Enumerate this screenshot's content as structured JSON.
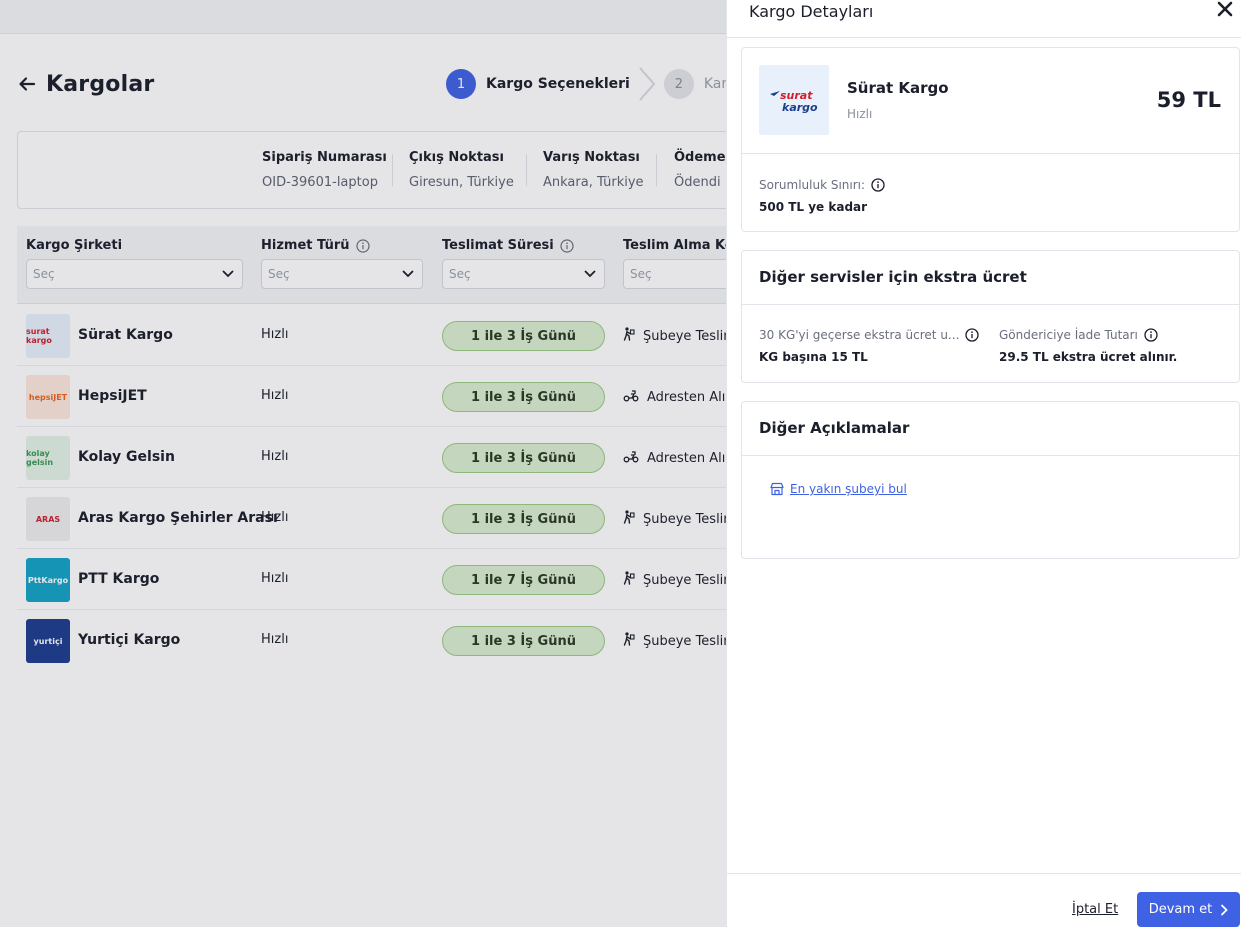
{
  "page": {
    "title": "Kargolar"
  },
  "stepper": {
    "steps": [
      {
        "number": "1",
        "label": "Kargo Seçenekleri"
      },
      {
        "number": "2",
        "label": "Kargo O"
      }
    ]
  },
  "order_info": {
    "fields": [
      {
        "label": "Sipariş Numarası",
        "value": "OID-39601-laptop"
      },
      {
        "label": "Çıkış Noktası",
        "value": "Giresun, Türkiye"
      },
      {
        "label": "Varış Noktası",
        "value": "Ankara, Türkiye"
      },
      {
        "label": "Ödeme T",
        "value": "Ödendi"
      }
    ]
  },
  "table": {
    "columns": [
      {
        "label": "Kargo Şirketi",
        "placeholder": "Seç"
      },
      {
        "label": "Hizmet Türü",
        "placeholder": "Seç"
      },
      {
        "label": "Teslimat Süresi",
        "placeholder": "Seç"
      },
      {
        "label": "Teslim Alma Koş",
        "placeholder": "Seç"
      }
    ],
    "rows": [
      {
        "company": "Sürat Kargo",
        "logo_text": "surat kargo",
        "logo_bg": "#e8f1fb",
        "logo_color": "#d0202e",
        "service": "Hızlı",
        "duration": "1 ile 3 İş Günü",
        "pickup": "Şubeye Teslim",
        "pickup_icon": "branch-dropoff-icon"
      },
      {
        "company": "HepsiJET",
        "logo_text": "hepsiJET",
        "logo_bg": "#fde7dd",
        "logo_color": "#e9651e",
        "service": "Hızlı",
        "duration": "1 ile 3 İş Günü",
        "pickup": "Adresten Alım",
        "pickup_icon": "courier-pickup-icon"
      },
      {
        "company": "Kolay Gelsin",
        "logo_text": "kolay gelsin",
        "logo_bg": "#e3f3e6",
        "logo_color": "#3a9a57",
        "service": "Hızlı",
        "duration": "1 ile 3 İş Günü",
        "pickup": "Adresten Alım",
        "pickup_icon": "courier-pickup-icon"
      },
      {
        "company": "Aras Kargo Şehirler Arası",
        "logo_text": "ARAS",
        "logo_bg": "#eeeeee",
        "logo_color": "#d0202e",
        "service": "Hızlı",
        "duration": "1 ile 3 İş Günü",
        "pickup": "Şubeye Teslim",
        "pickup_icon": "branch-dropoff-icon"
      },
      {
        "company": "PTT Kargo",
        "logo_text": "PttKargo",
        "logo_bg": "#14a3c7",
        "logo_color": "#ffffff",
        "service": "Hızlı",
        "duration": "1 ile 7 İş Günü",
        "pickup": "Şubeye Teslim",
        "pickup_icon": "branch-dropoff-icon"
      },
      {
        "company": "Yurtiçi Kargo",
        "logo_text": "yurtiçi",
        "logo_bg": "#1d3d8f",
        "logo_color": "#ffffff",
        "service": "Hızlı",
        "duration": "1 ile 3 İş Günü",
        "pickup": "Şubeye Teslim",
        "pickup_icon": "branch-dropoff-icon"
      }
    ]
  },
  "drawer": {
    "title": "Kargo Detayları",
    "carrier": {
      "name": "Sürat Kargo",
      "service": "Hızlı",
      "price": "59 TL",
      "logo_line1": "surat",
      "logo_line2": "kargo"
    },
    "liability": {
      "label": "Sorumluluk Sınırı:",
      "value": "500 TL ye kadar"
    },
    "extra_fees": {
      "title": "Diğer servisler için ekstra ücret",
      "items": [
        {
          "label": "30 KG'yi geçerse ekstra ücret u...",
          "value": "KG başına 15 TL"
        },
        {
          "label": "Göndericiye İade Tutarı",
          "value": "29.5 TL ekstra ücret alınır."
        }
      ]
    },
    "other_notes": {
      "title": "Diğer Açıklamalar",
      "link": "En yakın şubeyi bul"
    },
    "footer": {
      "cancel": "İptal Et",
      "continue": "Devam et"
    }
  },
  "colors": {
    "primary": "#3f62e4",
    "pill_bg": "#dbeed2",
    "pill_border": "#9ccb84"
  }
}
